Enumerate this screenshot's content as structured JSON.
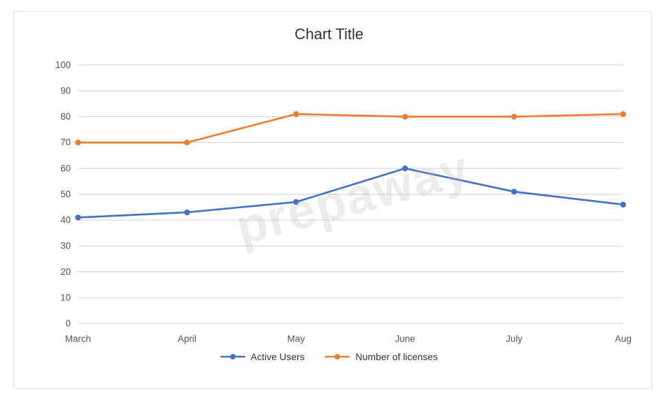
{
  "chart": {
    "title": "Chart Title",
    "watermark": "prepaway",
    "y_axis": {
      "labels": [
        0,
        10,
        20,
        30,
        40,
        50,
        60,
        70,
        80,
        90,
        100
      ]
    },
    "x_axis": {
      "labels": [
        "March",
        "April",
        "May",
        "June",
        "July",
        "Aug"
      ]
    },
    "series": {
      "active_users": {
        "label": "Active Users",
        "color": "#4472C4",
        "data": [
          41,
          43,
          47,
          60,
          51,
          46
        ]
      },
      "licenses": {
        "label": "Number of licenses",
        "color": "#ED7D31",
        "data": [
          70,
          70,
          81,
          80,
          80,
          81
        ]
      }
    }
  }
}
